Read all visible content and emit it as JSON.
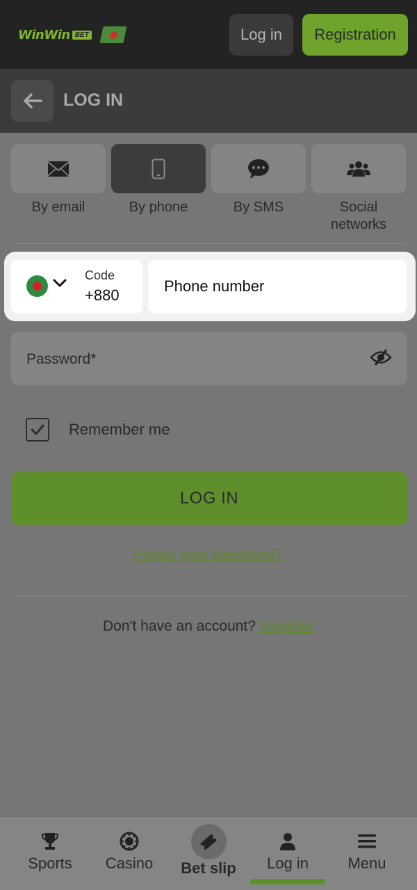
{
  "header": {
    "logo_text": "WinWin",
    "logo_badge": "BET",
    "login_label": "Log in",
    "register_label": "Registration"
  },
  "subheader": {
    "title": "LOG IN"
  },
  "tabs": [
    {
      "label": "By email",
      "icon": "envelope-icon",
      "active": false
    },
    {
      "label": "By phone",
      "icon": "phone-icon",
      "active": true
    },
    {
      "label": "By SMS",
      "icon": "chat-icon",
      "active": false
    },
    {
      "label": "Social networks",
      "icon": "users-icon",
      "active": false
    }
  ],
  "phone": {
    "code_label": "Code",
    "code_value": "+880",
    "placeholder": "Phone number"
  },
  "password": {
    "label": "Password*"
  },
  "remember": {
    "label": "Remember me",
    "checked": true
  },
  "login_button": "LOG IN",
  "forgot_link": "Forgot your password?",
  "no_account": {
    "text": "Don't have an account?",
    "link": "Register"
  },
  "bottom_nav": [
    {
      "label": "Sports",
      "icon": "trophy-icon"
    },
    {
      "label": "Casino",
      "icon": "chip-icon"
    },
    {
      "label": "Bet slip",
      "icon": "ticket-icon"
    },
    {
      "label": "Log in",
      "icon": "user-icon",
      "active": true
    },
    {
      "label": "Menu",
      "icon": "menu-icon"
    }
  ],
  "colors": {
    "accent": "#6fa32c",
    "topbar": "#232323",
    "overlay": "#767676"
  }
}
